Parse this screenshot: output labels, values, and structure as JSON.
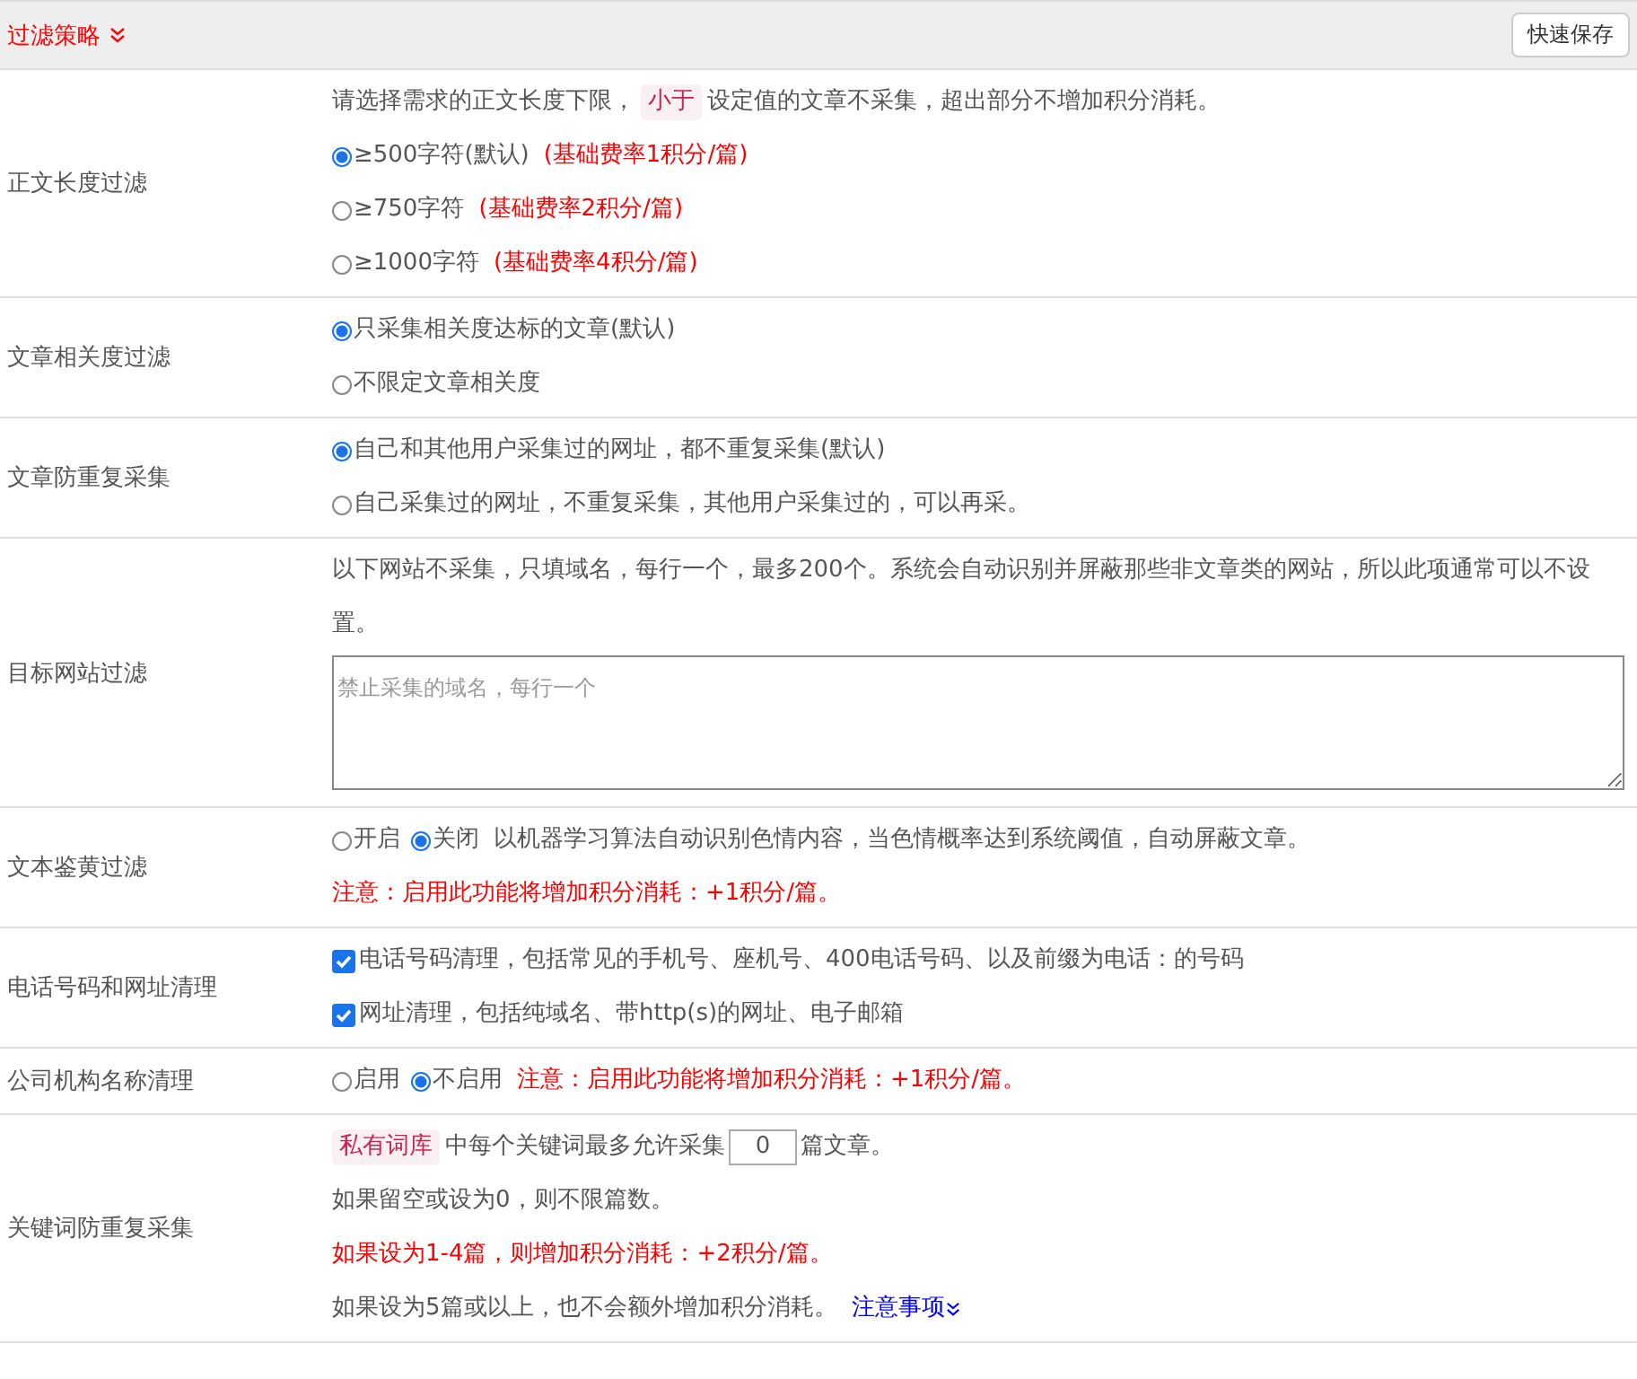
{
  "header": {
    "title": "过滤策略",
    "button": "快速保存"
  },
  "sections": [
    {
      "label": "正文长度过滤",
      "lines": [
        [
          {
            "kind": "text",
            "text": "请选择需求的正文长度下限，"
          },
          {
            "kind": "tag",
            "text": "小于"
          },
          {
            "kind": "text",
            "text": "设定值的文章不采集，超出部分不增加积分消耗。"
          }
        ],
        [
          {
            "kind": "radio",
            "label": "≥500字符(默认)",
            "selected": true
          },
          {
            "kind": "warn",
            "text": "(基础费率1积分/篇)"
          }
        ],
        [
          {
            "kind": "radio",
            "label": "≥750字符",
            "selected": false
          },
          {
            "kind": "warn",
            "text": "(基础费率2积分/篇)"
          }
        ],
        [
          {
            "kind": "radio",
            "label": "≥1000字符",
            "selected": false
          },
          {
            "kind": "warn",
            "text": "(基础费率4积分/篇)"
          }
        ]
      ]
    },
    {
      "label": "文章相关度过滤",
      "lines": [
        [
          {
            "kind": "radio",
            "label": "只采集相关度达标的文章(默认)",
            "selected": true
          }
        ],
        [
          {
            "kind": "radio",
            "label": "不限定文章相关度",
            "selected": false
          }
        ]
      ]
    },
    {
      "label": "文章防重复采集",
      "lines": [
        [
          {
            "kind": "radio",
            "label": "自己和其他用户采集过的网址，都不重复采集(默认)",
            "selected": true
          }
        ],
        [
          {
            "kind": "radio",
            "label": "自己采集过的网址，不重复采集，其他用户采集过的，可以再采。",
            "selected": false
          }
        ]
      ]
    },
    {
      "label": "目标网站过滤",
      "lines": [
        [
          {
            "kind": "text",
            "text": "以下网站不采集，只填域名，每行一个，最多200个。系统会自动识别并屏蔽那些非文章类的网站，所以此项通常可以不设置。"
          }
        ],
        [
          {
            "kind": "textarea",
            "placeholder": "禁止采集的域名，每行一个"
          }
        ]
      ]
    },
    {
      "label": "文本鉴黄过滤",
      "lines": [
        [
          {
            "kind": "radio",
            "label": "开启",
            "selected": false
          },
          {
            "kind": "radio",
            "label": "关闭",
            "selected": true
          },
          {
            "kind": "text",
            "text": "以机器学习算法自动识别色情内容，当色情概率达到系统阈值，自动屏蔽文章。"
          }
        ],
        [
          {
            "kind": "warn",
            "text": "注意：启用此功能将增加积分消耗：+1积分/篇。"
          }
        ]
      ]
    },
    {
      "label": "电话号码和网址清理",
      "lines": [
        [
          {
            "kind": "checkbox",
            "label": "电话号码清理，包括常见的手机号、座机号、400电话号码、以及前缀为电话：的号码",
            "checked": true
          }
        ],
        [
          {
            "kind": "checkbox",
            "label": "网址清理，包括纯域名、带http(s)的网址、电子邮箱",
            "checked": true
          }
        ]
      ]
    },
    {
      "label": "公司机构名称清理",
      "lines": [
        [
          {
            "kind": "radio",
            "label": "启用",
            "selected": false
          },
          {
            "kind": "radio",
            "label": "不启用",
            "selected": true
          },
          {
            "kind": "warn",
            "text": "注意：启用此功能将增加积分消耗：+1积分/篇。"
          }
        ]
      ]
    },
    {
      "label": "关键词防重复采集",
      "lines": [
        [
          {
            "kind": "tag",
            "text": "私有词库"
          },
          {
            "kind": "text",
            "text": "中每个关键词最多允许采集"
          },
          {
            "kind": "number",
            "value": "0"
          },
          {
            "kind": "text",
            "text": "篇文章。"
          }
        ],
        [
          {
            "kind": "text",
            "text": "如果留空或设为0，则不限篇数。"
          }
        ],
        [
          {
            "kind": "warn",
            "text": "如果设为1-4篇，则增加积分消耗：+2积分/篇。"
          }
        ],
        [
          {
            "kind": "text",
            "text": "如果设为5篇或以上，也不会额外增加积分消耗。"
          },
          {
            "kind": "link",
            "text": "注意事项"
          }
        ]
      ]
    }
  ]
}
